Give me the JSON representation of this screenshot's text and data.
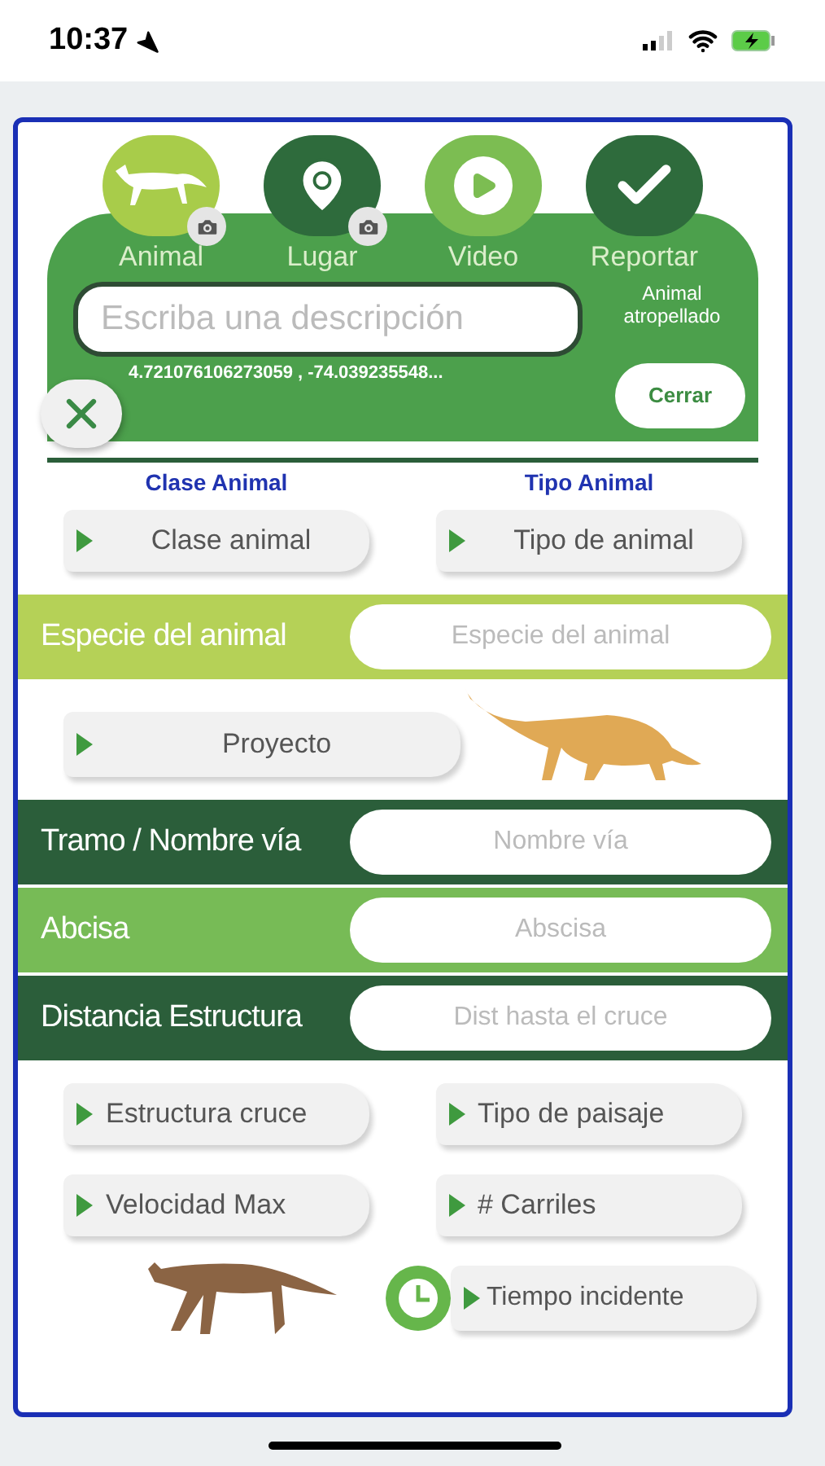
{
  "status_bar": {
    "time": "10:37"
  },
  "steps": [
    {
      "label": "Animal",
      "kind": "animal",
      "color": "#a8cc4a",
      "camera": true
    },
    {
      "label": "Lugar",
      "kind": "place",
      "color": "#2e6b3c",
      "camera": true
    },
    {
      "label": "Video",
      "kind": "video",
      "color": "#7cbd52",
      "camera": false
    },
    {
      "label": "Reportar",
      "kind": "report",
      "color": "#2e6b3c",
      "camera": false
    }
  ],
  "description": {
    "placeholder": "Escriba una descripción"
  },
  "report_type": "Animal atropellado",
  "close_button": "Cerrar",
  "coordinates": "4.721076106273059 , -74.039235548...",
  "selectors": [
    {
      "header": "Clase Animal",
      "button": "Clase animal"
    },
    {
      "header": "Tipo Animal",
      "button": "Tipo de animal"
    }
  ],
  "species_field": {
    "label": "Especie del animal",
    "placeholder": "Especie del animal",
    "color": "#b5d157"
  },
  "project_button": "Proyecto",
  "road_fields": [
    {
      "label": "Tramo / Nombre vía",
      "placeholder": "Nombre vía",
      "color": "#2b5e3a"
    },
    {
      "label": "Abcisa",
      "placeholder": "Abscisa",
      "color": "#77bb56"
    },
    {
      "label": "Distancia Estructura",
      "placeholder": "Dist hasta el cruce",
      "color": "#2b5e3a"
    }
  ],
  "options": [
    "Estructura cruce",
    "Tipo de paisaje",
    "Velocidad Max",
    "# Carriles"
  ],
  "time_button": "Tiempo incidente"
}
